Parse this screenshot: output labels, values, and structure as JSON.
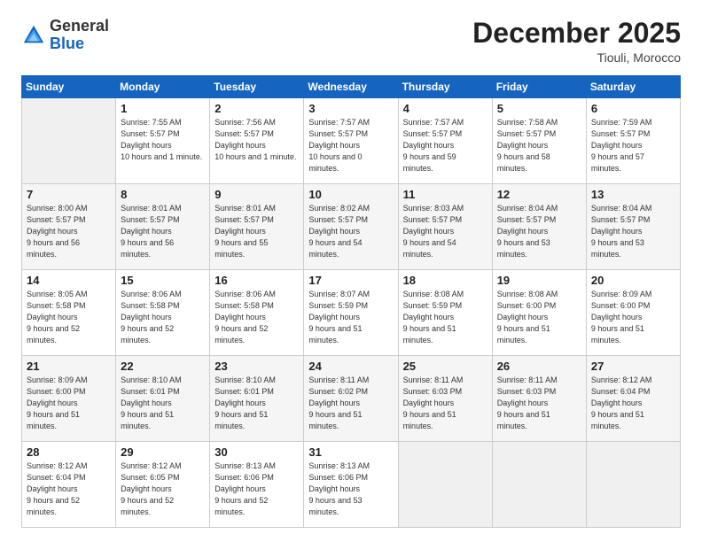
{
  "logo": {
    "general": "General",
    "blue": "Blue"
  },
  "header": {
    "month_year": "December 2025",
    "location": "Tiouli, Morocco"
  },
  "weekdays": [
    "Sunday",
    "Monday",
    "Tuesday",
    "Wednesday",
    "Thursday",
    "Friday",
    "Saturday"
  ],
  "weeks": [
    [
      null,
      {
        "num": "1",
        "sunrise": "7:55 AM",
        "sunset": "5:57 PM",
        "daylight": "10 hours and 1 minute."
      },
      {
        "num": "2",
        "sunrise": "7:56 AM",
        "sunset": "5:57 PM",
        "daylight": "10 hours and 1 minute."
      },
      {
        "num": "3",
        "sunrise": "7:57 AM",
        "sunset": "5:57 PM",
        "daylight": "10 hours and 0 minutes."
      },
      {
        "num": "4",
        "sunrise": "7:57 AM",
        "sunset": "5:57 PM",
        "daylight": "9 hours and 59 minutes."
      },
      {
        "num": "5",
        "sunrise": "7:58 AM",
        "sunset": "5:57 PM",
        "daylight": "9 hours and 58 minutes."
      },
      {
        "num": "6",
        "sunrise": "7:59 AM",
        "sunset": "5:57 PM",
        "daylight": "9 hours and 57 minutes."
      }
    ],
    [
      {
        "num": "7",
        "sunrise": "8:00 AM",
        "sunset": "5:57 PM",
        "daylight": "9 hours and 56 minutes."
      },
      {
        "num": "8",
        "sunrise": "8:01 AM",
        "sunset": "5:57 PM",
        "daylight": "9 hours and 56 minutes."
      },
      {
        "num": "9",
        "sunrise": "8:01 AM",
        "sunset": "5:57 PM",
        "daylight": "9 hours and 55 minutes."
      },
      {
        "num": "10",
        "sunrise": "8:02 AM",
        "sunset": "5:57 PM",
        "daylight": "9 hours and 54 minutes."
      },
      {
        "num": "11",
        "sunrise": "8:03 AM",
        "sunset": "5:57 PM",
        "daylight": "9 hours and 54 minutes."
      },
      {
        "num": "12",
        "sunrise": "8:04 AM",
        "sunset": "5:57 PM",
        "daylight": "9 hours and 53 minutes."
      },
      {
        "num": "13",
        "sunrise": "8:04 AM",
        "sunset": "5:57 PM",
        "daylight": "9 hours and 53 minutes."
      }
    ],
    [
      {
        "num": "14",
        "sunrise": "8:05 AM",
        "sunset": "5:58 PM",
        "daylight": "9 hours and 52 minutes."
      },
      {
        "num": "15",
        "sunrise": "8:06 AM",
        "sunset": "5:58 PM",
        "daylight": "9 hours and 52 minutes."
      },
      {
        "num": "16",
        "sunrise": "8:06 AM",
        "sunset": "5:58 PM",
        "daylight": "9 hours and 52 minutes."
      },
      {
        "num": "17",
        "sunrise": "8:07 AM",
        "sunset": "5:59 PM",
        "daylight": "9 hours and 51 minutes."
      },
      {
        "num": "18",
        "sunrise": "8:08 AM",
        "sunset": "5:59 PM",
        "daylight": "9 hours and 51 minutes."
      },
      {
        "num": "19",
        "sunrise": "8:08 AM",
        "sunset": "6:00 PM",
        "daylight": "9 hours and 51 minutes."
      },
      {
        "num": "20",
        "sunrise": "8:09 AM",
        "sunset": "6:00 PM",
        "daylight": "9 hours and 51 minutes."
      }
    ],
    [
      {
        "num": "21",
        "sunrise": "8:09 AM",
        "sunset": "6:00 PM",
        "daylight": "9 hours and 51 minutes."
      },
      {
        "num": "22",
        "sunrise": "8:10 AM",
        "sunset": "6:01 PM",
        "daylight": "9 hours and 51 minutes."
      },
      {
        "num": "23",
        "sunrise": "8:10 AM",
        "sunset": "6:01 PM",
        "daylight": "9 hours and 51 minutes."
      },
      {
        "num": "24",
        "sunrise": "8:11 AM",
        "sunset": "6:02 PM",
        "daylight": "9 hours and 51 minutes."
      },
      {
        "num": "25",
        "sunrise": "8:11 AM",
        "sunset": "6:03 PM",
        "daylight": "9 hours and 51 minutes."
      },
      {
        "num": "26",
        "sunrise": "8:11 AM",
        "sunset": "6:03 PM",
        "daylight": "9 hours and 51 minutes."
      },
      {
        "num": "27",
        "sunrise": "8:12 AM",
        "sunset": "6:04 PM",
        "daylight": "9 hours and 51 minutes."
      }
    ],
    [
      {
        "num": "28",
        "sunrise": "8:12 AM",
        "sunset": "6:04 PM",
        "daylight": "9 hours and 52 minutes."
      },
      {
        "num": "29",
        "sunrise": "8:12 AM",
        "sunset": "6:05 PM",
        "daylight": "9 hours and 52 minutes."
      },
      {
        "num": "30",
        "sunrise": "8:13 AM",
        "sunset": "6:06 PM",
        "daylight": "9 hours and 52 minutes."
      },
      {
        "num": "31",
        "sunrise": "8:13 AM",
        "sunset": "6:06 PM",
        "daylight": "9 hours and 53 minutes."
      },
      null,
      null,
      null
    ]
  ]
}
